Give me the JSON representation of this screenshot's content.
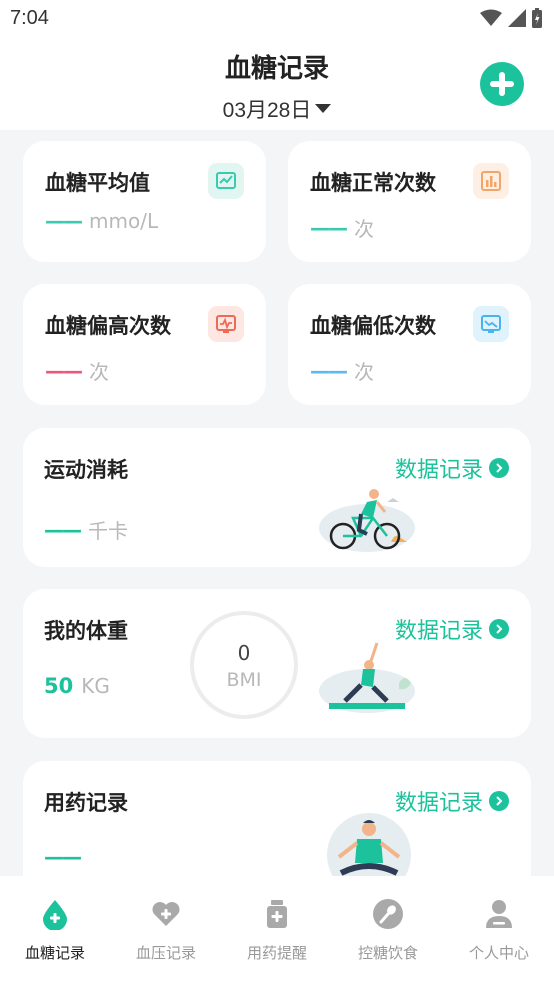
{
  "status_bar": {
    "time": "7:04"
  },
  "header": {
    "title": "血糖记录",
    "date": "03月28日"
  },
  "stats": [
    {
      "title": "血糖平均值",
      "dash": "——",
      "unit": "mmo/L",
      "dash_color": "#3cc9b0",
      "icon": "chart-line-icon",
      "icon_bg": "#e2f6f1",
      "icon_color": "#3cc9b0"
    },
    {
      "title": "血糖正常次数",
      "dash": "——",
      "unit": "次",
      "dash_color": "#3cc9b0",
      "icon": "bar-chart-icon",
      "icon_bg": "#fdefe3",
      "icon_color": "#f2a568"
    },
    {
      "title": "血糖偏高次数",
      "dash": "——",
      "unit": "次",
      "dash_color": "#f2557a",
      "icon": "monitor-pulse-icon",
      "icon_bg": "#fde7e3",
      "icon_color": "#ef6a55"
    },
    {
      "title": "血糖偏低次数",
      "dash": "——",
      "unit": "次",
      "dash_color": "#5cb9f0",
      "icon": "monitor-trend-icon",
      "icon_bg": "#e0f2fb",
      "icon_color": "#47b4ee"
    }
  ],
  "exercise": {
    "title": "运动消耗",
    "link": "数据记录",
    "dash": "——",
    "unit": "千卡",
    "illustration": "cyclist-illustration"
  },
  "weight": {
    "title": "我的体重",
    "link": "数据记录",
    "value": "50",
    "unit": "KG",
    "bmi_value": "0",
    "bmi_label": "BMI",
    "illustration": "yoga-illustration"
  },
  "medication": {
    "title": "用药记录",
    "link": "数据记录",
    "dash": "——",
    "illustration": "meditation-illustration"
  },
  "tabs": [
    {
      "label": "血糖记录",
      "icon": "blood-drop-icon",
      "active": true
    },
    {
      "label": "血压记录",
      "icon": "heart-plus-icon",
      "active": false
    },
    {
      "label": "用药提醒",
      "icon": "medicine-bottle-icon",
      "active": false
    },
    {
      "label": "控糖饮食",
      "icon": "spoon-icon",
      "active": false
    },
    {
      "label": "个人中心",
      "icon": "person-icon",
      "active": false
    }
  ],
  "colors": {
    "accent": "#1bc29b",
    "background": "#f4f5f7"
  }
}
